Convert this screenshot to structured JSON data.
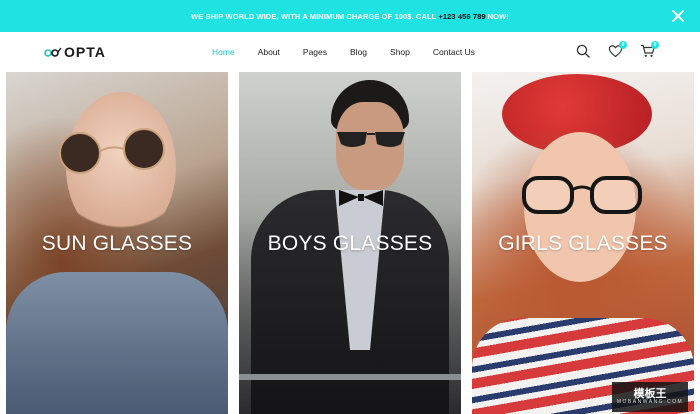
{
  "announcement": {
    "text_before": "We ship world wide, with a minimum charge of 100$. Call",
    "phone": "+123 456 789",
    "text_after": "Now!"
  },
  "logo": {
    "text": "OPTA"
  },
  "nav": {
    "items": [
      {
        "label": "Home",
        "active": true
      },
      {
        "label": "About"
      },
      {
        "label": "Pages"
      },
      {
        "label": "Blog"
      },
      {
        "label": "Shop"
      },
      {
        "label": "Contact Us"
      }
    ]
  },
  "header_icons": {
    "wishlist_count": "0",
    "cart_count": "0"
  },
  "categories": [
    {
      "title": "SUN GLASSES"
    },
    {
      "title": "BOYS GLASSES"
    },
    {
      "title": "GIRLS GLASSES"
    }
  ],
  "watermark": {
    "title": "模板王",
    "subtitle": "MOBANWANG.COM"
  },
  "colors": {
    "accent": "#1fe3e3",
    "active_nav": "#1fc7c7"
  }
}
